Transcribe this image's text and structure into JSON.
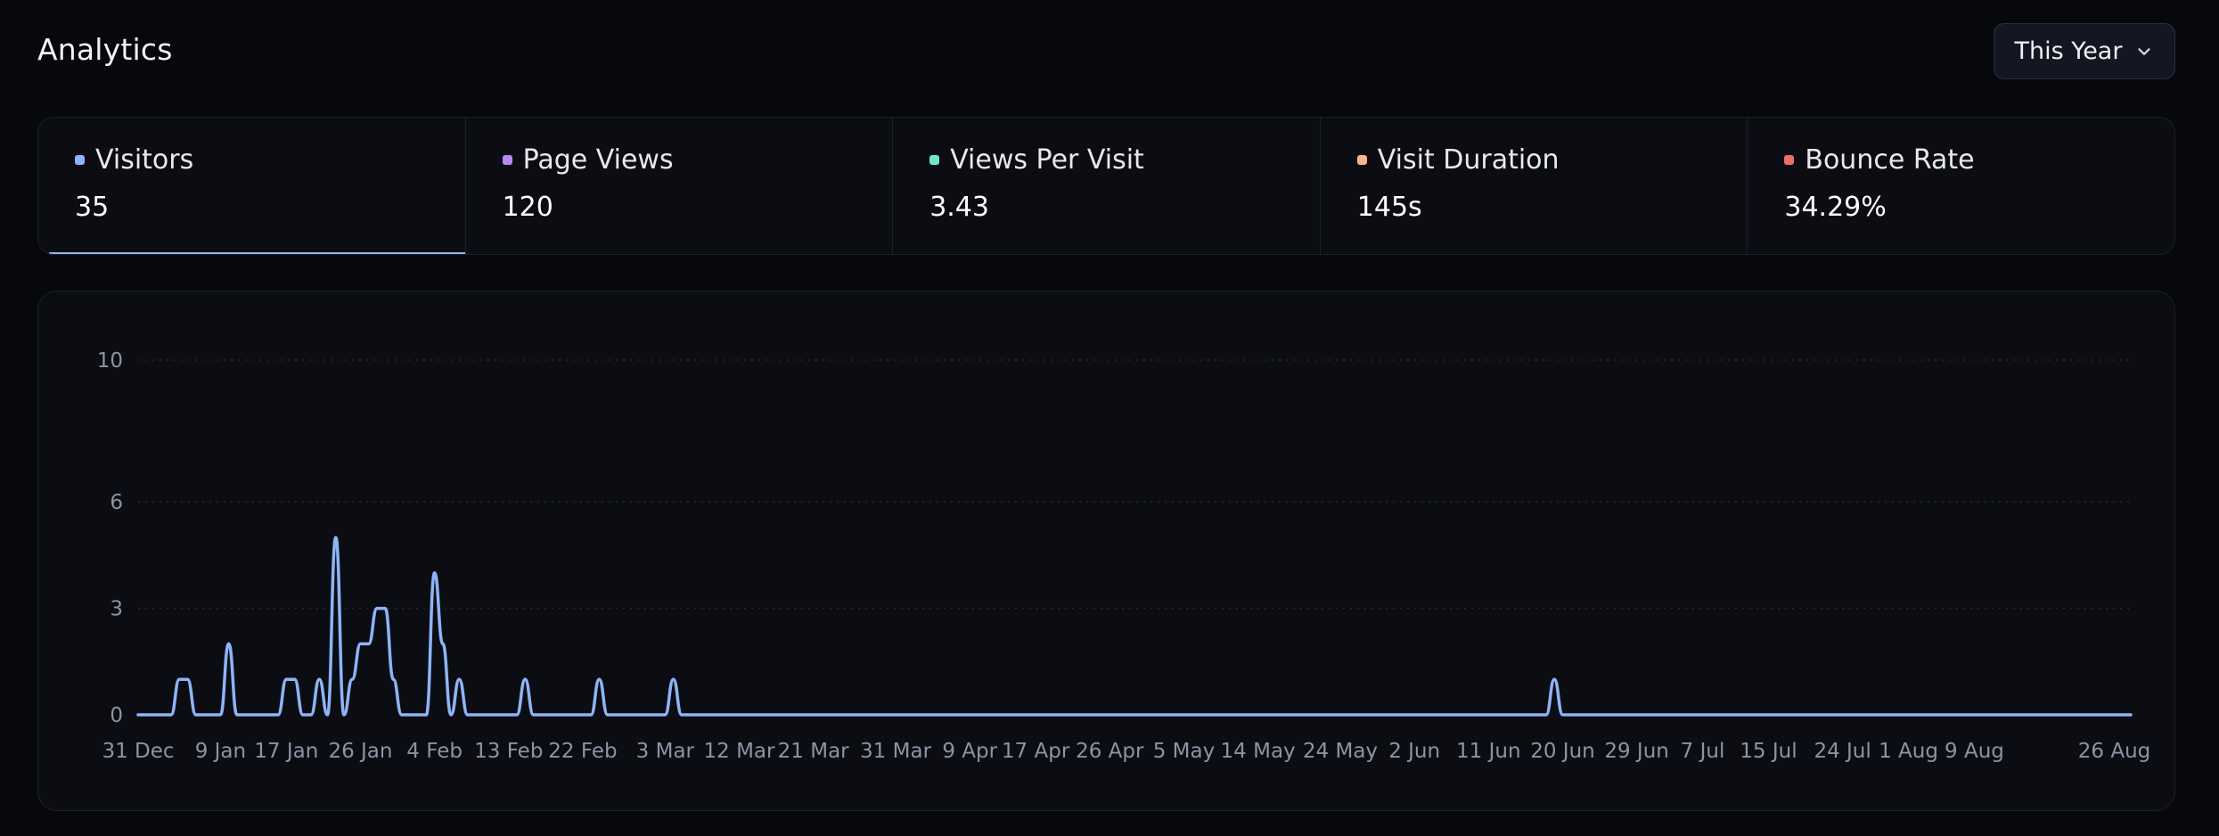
{
  "header": {
    "title": "Analytics"
  },
  "range_select": {
    "label": "This Year"
  },
  "stats": [
    {
      "label": "Visitors",
      "value": "35",
      "color": "#8eb4f5",
      "active": true
    },
    {
      "label": "Page Views",
      "value": "120",
      "color": "#b48cf2",
      "active": false
    },
    {
      "label": "Views Per Visit",
      "value": "3.43",
      "color": "#6ee7c8",
      "active": false
    },
    {
      "label": "Visit Duration",
      "value": "145s",
      "color": "#f7b48a",
      "active": false
    },
    {
      "label": "Bounce Rate",
      "value": "34.29%",
      "color": "#f26b6b",
      "active": false
    }
  ],
  "chart_data": {
    "type": "line",
    "series": [
      {
        "color": "#8eb4f5",
        "points": [
          [
            "31 Dec",
            0
          ],
          [
            "3 Jan",
            0
          ],
          [
            "4 Jan",
            1
          ],
          [
            "5 Jan",
            1
          ],
          [
            "6 Jan",
            0
          ],
          [
            "9 Jan",
            0
          ],
          [
            "10 Jan",
            2
          ],
          [
            "11 Jan",
            0
          ],
          [
            "16 Jan",
            0
          ],
          [
            "17 Jan",
            1
          ],
          [
            "18 Jan",
            1
          ],
          [
            "19 Jan",
            0
          ],
          [
            "20 Jan",
            0
          ],
          [
            "21 Jan",
            1
          ],
          [
            "22 Jan",
            0
          ],
          [
            "23 Jan",
            5
          ],
          [
            "24 Jan",
            0
          ],
          [
            "25 Jan",
            1
          ],
          [
            "26 Jan",
            2
          ],
          [
            "27 Jan",
            2
          ],
          [
            "28 Jan",
            3
          ],
          [
            "29 Jan",
            3
          ],
          [
            "30 Jan",
            1
          ],
          [
            "31 Jan",
            0
          ],
          [
            "3 Feb",
            0
          ],
          [
            "4 Feb",
            4
          ],
          [
            "5 Feb",
            2
          ],
          [
            "6 Feb",
            0
          ],
          [
            "7 Feb",
            1
          ],
          [
            "8 Feb",
            0
          ],
          [
            "14 Feb",
            0
          ],
          [
            "15 Feb",
            1
          ],
          [
            "16 Feb",
            0
          ],
          [
            "23 Feb",
            0
          ],
          [
            "24 Feb",
            1
          ],
          [
            "25 Feb",
            0
          ],
          [
            "3 Mar",
            0
          ],
          [
            "4 Mar",
            1
          ],
          [
            "5 Mar",
            0
          ],
          [
            "18 Jun",
            0
          ],
          [
            "19 Jun",
            1
          ],
          [
            "20 Jun",
            0
          ],
          [
            "28 Aug",
            0
          ]
        ]
      }
    ],
    "x_ticks": [
      "31 Dec",
      "9 Jan",
      "17 Jan",
      "26 Jan",
      "4 Feb",
      "13 Feb",
      "22 Feb",
      "3 Mar",
      "12 Mar",
      "21 Mar",
      "31 Mar",
      "9 Apr",
      "17 Apr",
      "26 Apr",
      "5 May",
      "14 May",
      "24 May",
      "2 Jun",
      "11 Jun",
      "20 Jun",
      "29 Jun",
      "7 Jul",
      "15 Jul",
      "24 Jul",
      "1 Aug",
      "9 Aug",
      "26 Aug"
    ],
    "y_ticks": [
      0,
      3,
      6,
      10
    ],
    "ylim": [
      0,
      10
    ],
    "xlim": [
      "31 Dec",
      "28 Aug"
    ],
    "grid": "dotted horizontal"
  }
}
